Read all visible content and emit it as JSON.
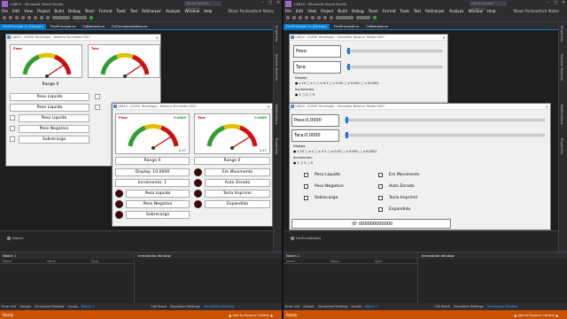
{
  "vs": {
    "title": "LAB10 - Microsoft Visual Studio",
    "search": "Quick Launch (Ctrl+Q)",
    "menu": [
      "File",
      "Edit",
      "View",
      "Project",
      "Build",
      "Debug",
      "Team",
      "Format",
      "Tools",
      "Test",
      "ReSharper",
      "Analyze",
      "Window",
      "Help"
    ],
    "user": "Tobias Pankowitsch Mateo",
    "status": "Ready",
    "source_control": "▲ Add to Source Control ▲",
    "rail_left": [
      "Properties",
      "Solution Explorer",
      "Notifications",
      "Properties"
    ],
    "watch_title": "Watch 1",
    "watch_cols": [
      "Name",
      "Value",
      "Type"
    ],
    "immediate_title": "Immediate Window",
    "left_tabs": [
      "Error List",
      "Output",
      "Command Window",
      "Locals",
      "Watch 1"
    ],
    "right_tabs": [
      "Call Stack",
      "Exception Settings",
      "Immediate Window"
    ]
  },
  "left": {
    "tabs": [
      "FrmPrincipal.cs [Design]",
      "FrmPrincipal.cs",
      "CsBanxels.cs",
      "CsFuncionesDatos.cs"
    ],
    "tray": "timer1",
    "form_bg": {
      "title": "LAB10 - 0059X Tecnologia - Balanca Simulador 0007",
      "gauge1": "Peso",
      "gauge2": "Tara",
      "range": "Range 0",
      "buttons": [
        "Peso Liquido",
        "Peso Liquido",
        "Peso Liquido",
        "Peso Negativo",
        "Sobrecarga"
      ]
    },
    "form_fg": {
      "title": "LAB10 - 0059X Tecnologia - Balanca Simulador 0007",
      "gauge1": "Peso",
      "gauge1_value": "0.0000",
      "gauge1_small": "4.47",
      "gauge2": "Tara",
      "gauge2_value": "0.0000",
      "gauge2_small": "4.47",
      "range1": "Range 0",
      "range2": "Range 0",
      "display": "Display: 10,0000",
      "incremento": "Incremento: 1",
      "left_buttons": [
        "Peso Liquido",
        "Peso Negativo",
        "Sobrecarga"
      ],
      "right_buttons": [
        "Em Movimento",
        "Auto Zerado",
        "Tecla Imprimir",
        "Expandido"
      ]
    }
  },
  "right": {
    "tabs": [
      "FrmPrincipal.cs [Design]",
      "FrmPrincipal.cs",
      "CsBanxels.cs"
    ],
    "tray": "tmrEnviaDatos",
    "form_bg": {
      "title": "LAB10 - 0059X Tecnologia - Simulador Balanca Toledo 0007",
      "peso_label": "Peso:",
      "tara_label": "Tara:",
      "display_label": "Display:",
      "display_opts": "● x 10  ○ x 1  ○ x 0.1  ○ x 0.01  ○ x 0.001  ○ x 0.0001",
      "incr_label": "Incremento:",
      "incr_opts": "● 1  ○ 2  ○ 5"
    },
    "form_fg": {
      "title": "LAB10 - 0059X Tecnologia - Simulador Balanca Toledo 0007",
      "peso": "Peso:0,0000",
      "tara": "Tara:0,0000",
      "display_label": "Display:",
      "display_opts": "● x 10  ○ x 1  ○ x 0.1  ○ x 0.01  ○ x 0.001  ○ x 0.0001",
      "incr_label": "Incremento:",
      "incr_opts": "● 1  ○ 2  ○ 5",
      "checks_left": [
        "Peso Liquido",
        "Peso Negativo",
        "Sobrecarga"
      ],
      "checks_right": [
        "Em Movimento",
        "Auto Zerado",
        "Tecla Imprimir",
        "Expandido"
      ],
      "output": ")0' 000000000000"
    }
  }
}
